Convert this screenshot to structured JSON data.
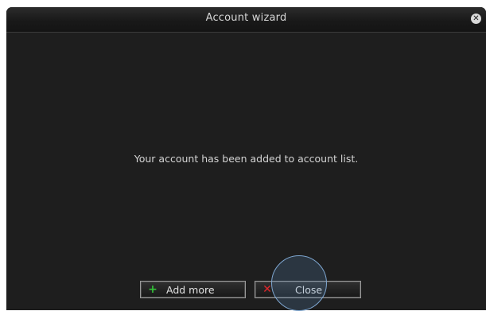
{
  "window": {
    "title": "Account wizard",
    "close_icon": "close-x-icon",
    "close_glyph": "✕"
  },
  "message": "Your account has been added to account list.",
  "buttons": {
    "add_more": {
      "label": "Add more",
      "icon": "plus-icon",
      "icon_glyph": "+",
      "icon_color": "#34c43a"
    },
    "close": {
      "label": "Close",
      "icon": "x-icon",
      "icon_glyph": "✕",
      "icon_color": "#e0262b"
    }
  },
  "theme": {
    "background": "#1e1e1e",
    "text": "#d4d4d4",
    "titlebar_text": "#d7d7d7",
    "highlight_ring": "#7ea6d0"
  }
}
